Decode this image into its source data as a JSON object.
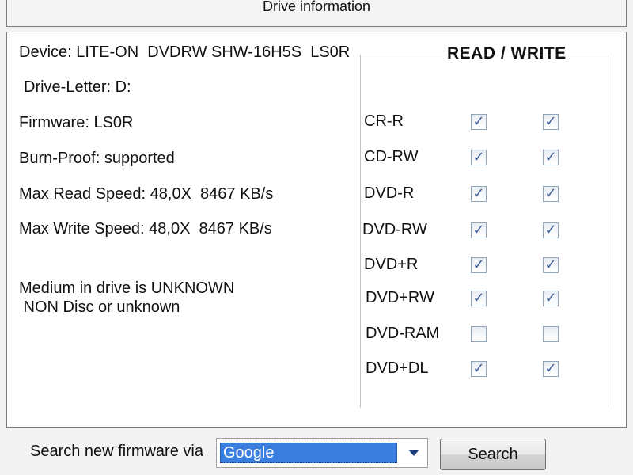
{
  "window": {
    "title": "Drive information"
  },
  "device_info": {
    "device": "Device: LITE-ON  DVDRW SHW-16H5S  LS0R",
    "drive_letter": "Drive-Letter: D:",
    "firmware": "Firmware: LS0R",
    "burn_proof": "Burn-Proof: supported",
    "max_read": "Max Read Speed: 48,0X  8467 KB/s",
    "max_write": "Max Write Speed: 48,0X  8467 KB/s",
    "medium_line1": "Medium in drive is UNKNOWN",
    "medium_line2": " NON Disc or unknown"
  },
  "capabilities": {
    "header": "READ / WRITE",
    "formats": [
      {
        "label": "CR-R",
        "read": true,
        "write": true
      },
      {
        "label": "CD-RW",
        "read": true,
        "write": true
      },
      {
        "label": "DVD-R",
        "read": true,
        "write": true
      },
      {
        "label": "DVD-RW",
        "read": true,
        "write": true
      },
      {
        "label": "DVD+R",
        "read": true,
        "write": true
      },
      {
        "label": "DVD+RW",
        "read": true,
        "write": true
      },
      {
        "label": "DVD-RAM",
        "read": false,
        "write": false
      },
      {
        "label": "DVD+DL",
        "read": true,
        "write": true
      }
    ]
  },
  "firmware_search": {
    "label": "Search new firmware via",
    "selected_engine": "Google",
    "button_label": "Search"
  },
  "colors": {
    "selection": "#3a7fe0",
    "check": "#3a5a9a"
  }
}
